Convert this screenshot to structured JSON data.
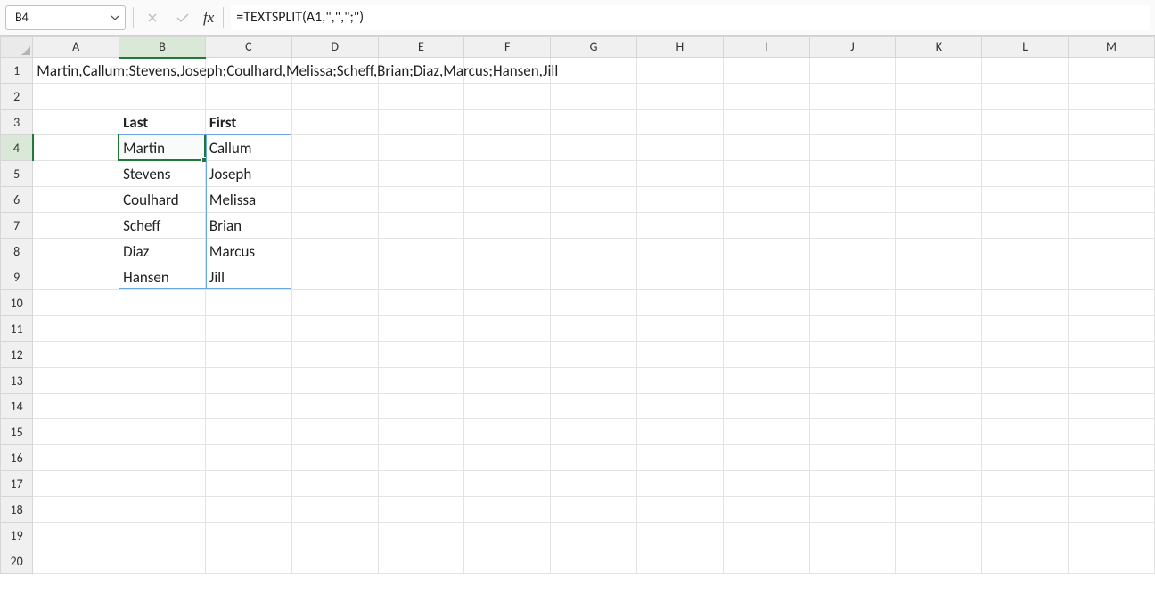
{
  "formula_bar": {
    "cell_ref": "B4",
    "formula": "=TEXTSPLIT(A1,\",\",\";\")",
    "fx_label": "fx"
  },
  "columns": [
    "A",
    "B",
    "C",
    "D",
    "E",
    "F",
    "G",
    "H",
    "I",
    "J",
    "K",
    "L",
    "M"
  ],
  "row_count": 20,
  "active": {
    "col": "B",
    "row": 4
  },
  "spill_range": {
    "col_start": "B",
    "col_end": "C",
    "row_start": 4,
    "row_end": 9
  },
  "cells": {
    "A1": "Martin,Callum;Stevens,Joseph;Coulhard,Melissa;Scheff,Brian;Diaz,Marcus;Hansen,Jill",
    "B3": "Last",
    "C3": "First",
    "B4": "Martin",
    "C4": "Callum",
    "B5": "Stevens",
    "C5": "Joseph",
    "B6": "Coulhard",
    "C6": "Melissa",
    "B7": "Scheff",
    "C7": "Brian",
    "B8": "Diaz",
    "C8": "Marcus",
    "B9": "Hansen",
    "C9": "Jill"
  },
  "bold_cells": [
    "B3",
    "C3"
  ],
  "chart_data": {
    "type": "table",
    "title": "TEXTSPLIT result",
    "columns": [
      "Last",
      "First"
    ],
    "rows": [
      [
        "Martin",
        "Callum"
      ],
      [
        "Stevens",
        "Joseph"
      ],
      [
        "Coulhard",
        "Melissa"
      ],
      [
        "Scheff",
        "Brian"
      ],
      [
        "Diaz",
        "Marcus"
      ],
      [
        "Hansen",
        "Jill"
      ]
    ],
    "source_cell": "A1",
    "source_value": "Martin,Callum;Stevens,Joseph;Coulhard,Melissa;Scheff,Brian;Diaz,Marcus;Hansen,Jill",
    "formula": "=TEXTSPLIT(A1,\",\",\";\")"
  }
}
